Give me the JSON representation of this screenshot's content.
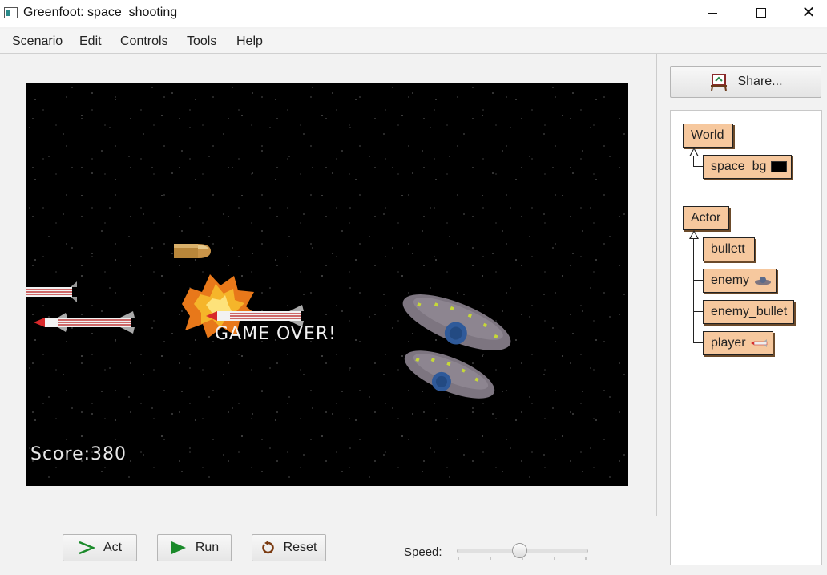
{
  "window": {
    "title": "Greenfoot: space_shooting",
    "icon": "greenfoot-app-icon",
    "minimize_icon": "minimize-icon",
    "maximize_icon": "maximize-icon",
    "close_glyph": "✕"
  },
  "menu": {
    "items": [
      {
        "label": "Scenario"
      },
      {
        "label": "Edit"
      },
      {
        "label": "Controls"
      },
      {
        "label": "Tools"
      },
      {
        "label": "Help"
      }
    ]
  },
  "world": {
    "score_text": "Score:380",
    "gameover_text": "GAME OVER!",
    "background": "#000000"
  },
  "controls": {
    "act_label": "Act",
    "run_label": "Run",
    "reset_label": "Reset",
    "speed_label": "Speed:",
    "speed_fraction": 0.48
  },
  "share": {
    "label": "Share...",
    "icon": "share-easel-icon"
  },
  "classes": {
    "world_root": "World",
    "world_sub": [
      {
        "label": "space_bg",
        "icon": "space-bg-thumb-icon"
      }
    ],
    "actor_root": "Actor",
    "actor_sub": [
      {
        "label": "bullett",
        "icon": ""
      },
      {
        "label": "enemy",
        "icon": "enemy-ufo-thumb-icon"
      },
      {
        "label": "enemy_bullet",
        "icon": ""
      },
      {
        "label": "player",
        "icon": "player-missile-thumb-icon"
      }
    ],
    "box_color": "#f6c89e"
  },
  "colors": {
    "run_green": "#1a8a2a",
    "act_green": "#1a8a2a",
    "reset_brown": "#7a3a10"
  }
}
